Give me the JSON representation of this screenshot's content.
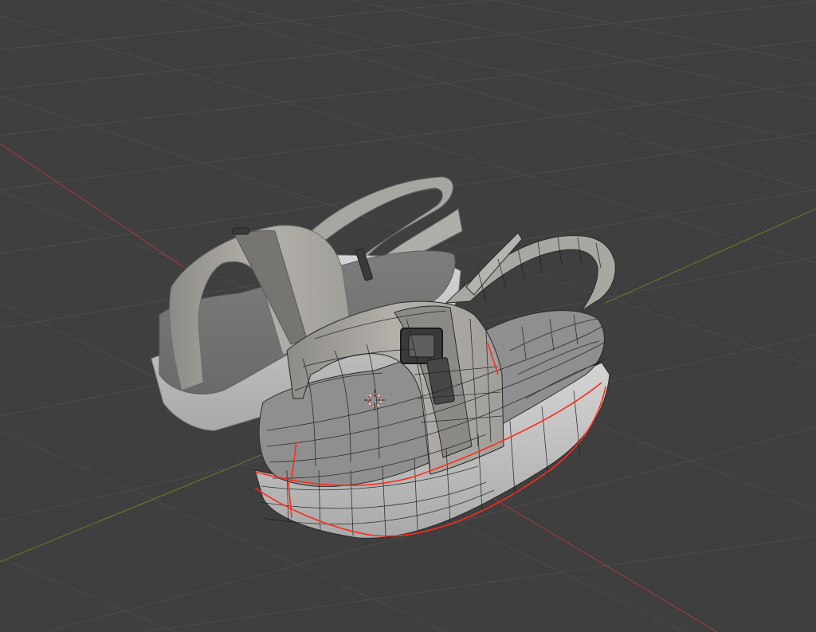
{
  "viewport": {
    "mode": "edit-mode",
    "shading": "solid",
    "overlay_wireframe": true
  },
  "colors": {
    "background": "#3f3f3f",
    "grid": "#4b4b4b",
    "x_axis": "#9a3a3a",
    "y_axis": "#5a7a2a",
    "mesh_light": "#b9b7b2",
    "mesh_mid": "#9e9c97",
    "mesh_dark": "#7f7e7b",
    "sole": "#c9c9c9",
    "seam": "#ff2a1a",
    "wire": "#1c1c1c",
    "buckle": "#3a3a3a"
  },
  "objects": [
    {
      "name": "sandal-back",
      "selected": false,
      "icon": "mesh-object"
    },
    {
      "name": "sandal-front",
      "selected": true,
      "icon": "mesh-object"
    }
  ],
  "cursor_3d": {
    "icon": "3d-cursor-icon"
  }
}
